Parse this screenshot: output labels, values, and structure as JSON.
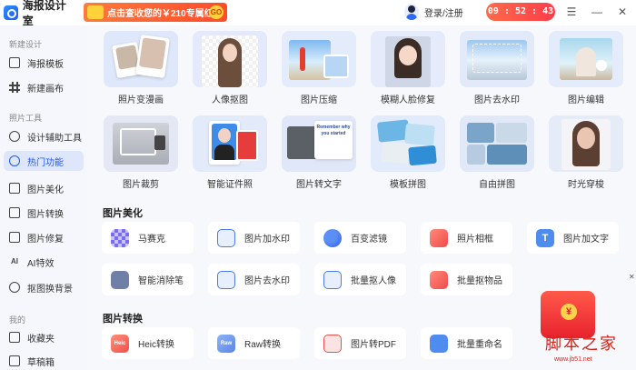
{
  "app": {
    "title": "海报设计室"
  },
  "promo": {
    "text": "点击查收您的￥210专属红包",
    "go": "GO"
  },
  "user": {
    "login": "登录/注册"
  },
  "timer": "09 : 52 : 43 . 50",
  "sidebar": {
    "sections": [
      {
        "title": "新建设计",
        "items": [
          {
            "label": "海报模板"
          },
          {
            "label": "新建画布"
          }
        ]
      },
      {
        "title": "照片工具",
        "items": [
          {
            "label": "设计辅助工具"
          },
          {
            "label": "热门功能"
          },
          {
            "label": "图片美化"
          },
          {
            "label": "图片转换"
          },
          {
            "label": "图片修复"
          },
          {
            "label": "AI特效"
          },
          {
            "label": "抠图换背景"
          }
        ]
      },
      {
        "title": "我的",
        "items": [
          {
            "label": "收藏夹"
          },
          {
            "label": "草稿箱"
          }
        ]
      }
    ]
  },
  "hot": {
    "row1": [
      "照片变漫画",
      "人像抠图",
      "图片压缩",
      "模糊人脸修复",
      "图片去水印",
      "图片编辑"
    ],
    "row2": [
      "图片裁剪",
      "智能证件照",
      "图片转文字",
      "模板拼图",
      "自由拼图",
      "时光穿梭"
    ],
    "ocr_caption": "Remember why you started"
  },
  "beautify": {
    "title": "图片美化",
    "row1": [
      "马赛克",
      "图片加水印",
      "百变滤镜",
      "照片相框",
      "图片加文字"
    ],
    "row2": [
      "智能消除笔",
      "图片去水印",
      "批量抠人像",
      "批量抠物品"
    ]
  },
  "convert": {
    "title": "图片转换",
    "items": [
      "Heic转换",
      "Raw转换",
      "图片转PDF",
      "批量重命名"
    ],
    "icon_texts": [
      "Heic",
      "Raw"
    ]
  },
  "watermark": {
    "mark": "脚本之家",
    "url": "www.jb51.net"
  },
  "colors": {
    "accent": "#1f5af0",
    "promo": "#ff4b2b"
  }
}
